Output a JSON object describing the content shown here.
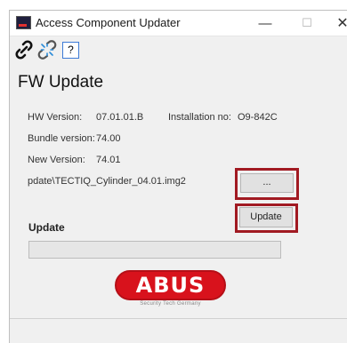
{
  "window": {
    "title": "Access Component Updater",
    "controls": {
      "minimize": "—",
      "maximize": "☐",
      "close": "✕"
    }
  },
  "toolbar": {
    "icons": [
      "link-icon",
      "unlink-icon"
    ],
    "help_label": "?"
  },
  "main": {
    "heading": "FW Update",
    "hw_version_label": "HW Version:",
    "hw_version_value": "07.01.01.B",
    "installation_label": "Installation no:",
    "installation_value": "O9-842C",
    "bundle_version_label": "Bundle version:",
    "bundle_version_value": "74.00",
    "new_version_label": "New Version:",
    "new_version_value": "74.01",
    "file_path": "pdate\\TECTIQ_Cylinder_04.01.img2",
    "browse_label": "...",
    "update_button_label": "Update",
    "update_section_label": "Update",
    "progress": 0
  },
  "logo": {
    "brand": "ABUS",
    "tagline": "Security Tech Germany"
  },
  "colors": {
    "highlight": "#a11a22",
    "brand_red": "#d8121c",
    "progress": "#2bb045"
  }
}
